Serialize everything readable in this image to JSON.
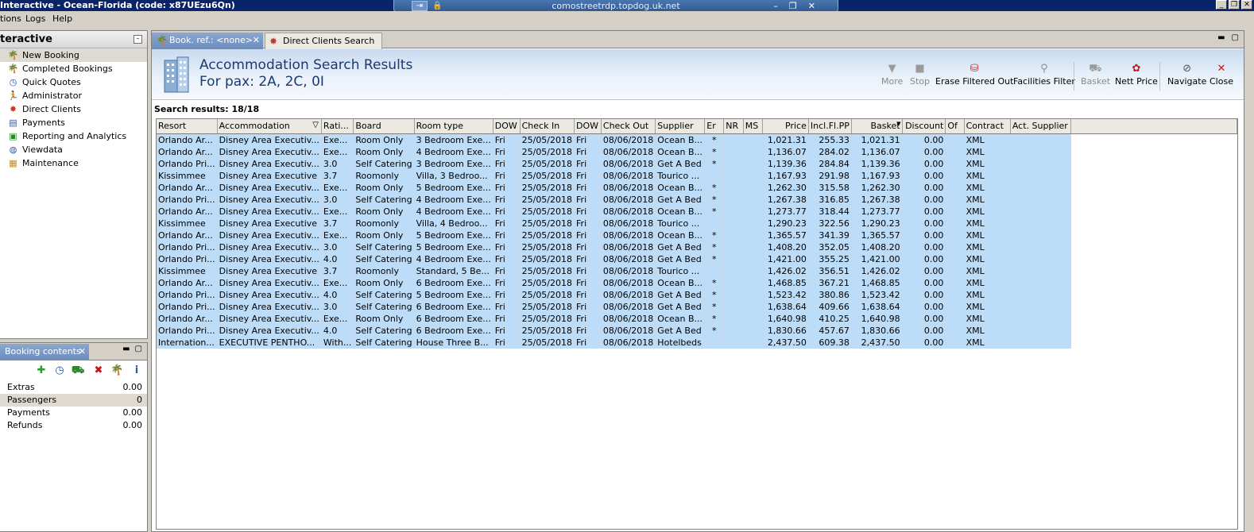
{
  "window": {
    "title": "Interactive - Ocean-Florida (code: x87UEzu6Qn)",
    "rdp_host": "comostreetrdp.topdog.uk.net"
  },
  "menu": [
    "tions",
    "Logs",
    "Help"
  ],
  "left_panel": {
    "title": "teractive",
    "items": [
      {
        "label": "New Booking",
        "icon": "palm-tree-icon"
      },
      {
        "label": "Completed Bookings",
        "icon": "palm-tree-icon"
      },
      {
        "label": "Quick Quotes",
        "icon": "clock-icon"
      },
      {
        "label": "Administrator",
        "icon": "person-icon"
      },
      {
        "label": "Direct Clients",
        "icon": "clients-icon"
      },
      {
        "label": "Payments",
        "icon": "payments-icon"
      },
      {
        "label": "Reporting and Analytics",
        "icon": "report-icon"
      },
      {
        "label": "Viewdata",
        "icon": "globe-icon"
      },
      {
        "label": "Maintenance",
        "icon": "books-icon"
      }
    ]
  },
  "booking_contents": {
    "tab_label": "Booking contents",
    "rows": [
      {
        "label": "Extras",
        "value": "0.00"
      },
      {
        "label": "Passengers",
        "value": "0"
      },
      {
        "label": "Payments",
        "value": "0.00"
      },
      {
        "label": "Refunds",
        "value": "0.00"
      }
    ]
  },
  "tabs": [
    {
      "label": "Book. ref.: <none>"
    },
    {
      "label": "Direct Clients Search"
    }
  ],
  "header": {
    "title": "Accommodation Search Results",
    "subtitle": "For pax: 2A, 2C, 0I"
  },
  "toolbar": {
    "more": "More",
    "stop": "Stop",
    "erase_filtered": "Erase Filtered Out",
    "facilities_filter": "Facilities Filter",
    "basket": "Basket",
    "nett_price": "Nett Price",
    "navigate": "Navigate",
    "close": "Close"
  },
  "results_label": "Search results: 18/18",
  "table": {
    "columns": [
      "Resort",
      "Accommodation",
      "Rati...",
      "Board",
      "Room type",
      "DOW",
      "Check In",
      "DOW",
      "Check Out",
      "Supplier",
      "Er",
      "NR",
      "MS",
      "Price",
      "Incl.Fl.PP",
      "Basket",
      "Discount",
      "Of",
      "Contract",
      "Act. Supplier"
    ],
    "rows": [
      [
        "Orlando Ar...",
        "Disney Area Executiv...",
        "Exe...",
        "Room Only",
        "3 Bedroom Exe...",
        "Fri",
        "25/05/2018",
        "Fri",
        "08/06/2018",
        "Ocean B...",
        "*",
        "",
        "",
        "1,021.31",
        "255.33",
        "1,021.31",
        "0.00",
        "",
        "XML",
        ""
      ],
      [
        "Orlando Ar...",
        "Disney Area Executiv...",
        "Exe...",
        "Room Only",
        "4 Bedroom Exe...",
        "Fri",
        "25/05/2018",
        "Fri",
        "08/06/2018",
        "Ocean B...",
        "*",
        "",
        "",
        "1,136.07",
        "284.02",
        "1,136.07",
        "0.00",
        "",
        "XML",
        ""
      ],
      [
        "Orlando Pri...",
        "Disney Area Executiv...",
        "3.0",
        "Self Catering",
        "3 Bedroom Exe...",
        "Fri",
        "25/05/2018",
        "Fri",
        "08/06/2018",
        "Get A Bed",
        "*",
        "",
        "",
        "1,139.36",
        "284.84",
        "1,139.36",
        "0.00",
        "",
        "XML",
        ""
      ],
      [
        "Kissimmee",
        "Disney Area Executive",
        "3.7",
        "Roomonly",
        "Villa, 3 Bedroo...",
        "Fri",
        "25/05/2018",
        "Fri",
        "08/06/2018",
        "Tourico ...",
        "",
        "",
        "",
        "1,167.93",
        "291.98",
        "1,167.93",
        "0.00",
        "",
        "XML",
        ""
      ],
      [
        "Orlando Ar...",
        "Disney Area Executiv...",
        "Exe...",
        "Room Only",
        "5 Bedroom Exe...",
        "Fri",
        "25/05/2018",
        "Fri",
        "08/06/2018",
        "Ocean B...",
        "*",
        "",
        "",
        "1,262.30",
        "315.58",
        "1,262.30",
        "0.00",
        "",
        "XML",
        ""
      ],
      [
        "Orlando Pri...",
        "Disney Area Executiv...",
        "3.0",
        "Self Catering",
        "4 Bedroom Exe...",
        "Fri",
        "25/05/2018",
        "Fri",
        "08/06/2018",
        "Get A Bed",
        "*",
        "",
        "",
        "1,267.38",
        "316.85",
        "1,267.38",
        "0.00",
        "",
        "XML",
        ""
      ],
      [
        "Orlando Ar...",
        "Disney Area Executiv...",
        "Exe...",
        "Room Only",
        "4 Bedroom Exe...",
        "Fri",
        "25/05/2018",
        "Fri",
        "08/06/2018",
        "Ocean B...",
        "*",
        "",
        "",
        "1,273.77",
        "318.44",
        "1,273.77",
        "0.00",
        "",
        "XML",
        ""
      ],
      [
        "Kissimmee",
        "Disney Area Executive",
        "3.7",
        "Roomonly",
        "Villa, 4 Bedroo...",
        "Fri",
        "25/05/2018",
        "Fri",
        "08/06/2018",
        "Tourico ...",
        "",
        "",
        "",
        "1,290.23",
        "322.56",
        "1,290.23",
        "0.00",
        "",
        "XML",
        ""
      ],
      [
        "Orlando Ar...",
        "Disney Area Executiv...",
        "Exe...",
        "Room Only",
        "5 Bedroom Exe...",
        "Fri",
        "25/05/2018",
        "Fri",
        "08/06/2018",
        "Ocean B...",
        "*",
        "",
        "",
        "1,365.57",
        "341.39",
        "1,365.57",
        "0.00",
        "",
        "XML",
        ""
      ],
      [
        "Orlando Pri...",
        "Disney Area Executiv...",
        "3.0",
        "Self Catering",
        "5 Bedroom Exe...",
        "Fri",
        "25/05/2018",
        "Fri",
        "08/06/2018",
        "Get A Bed",
        "*",
        "",
        "",
        "1,408.20",
        "352.05",
        "1,408.20",
        "0.00",
        "",
        "XML",
        ""
      ],
      [
        "Orlando Pri...",
        "Disney Area Executiv...",
        "4.0",
        "Self Catering",
        "4 Bedroom Exe...",
        "Fri",
        "25/05/2018",
        "Fri",
        "08/06/2018",
        "Get A Bed",
        "*",
        "",
        "",
        "1,421.00",
        "355.25",
        "1,421.00",
        "0.00",
        "",
        "XML",
        ""
      ],
      [
        "Kissimmee",
        "Disney Area Executive",
        "3.7",
        "Roomonly",
        "Standard, 5 Be...",
        "Fri",
        "25/05/2018",
        "Fri",
        "08/06/2018",
        "Tourico ...",
        "",
        "",
        "",
        "1,426.02",
        "356.51",
        "1,426.02",
        "0.00",
        "",
        "XML",
        ""
      ],
      [
        "Orlando Ar...",
        "Disney Area Executiv...",
        "Exe...",
        "Room Only",
        "6 Bedroom Exe...",
        "Fri",
        "25/05/2018",
        "Fri",
        "08/06/2018",
        "Ocean B...",
        "*",
        "",
        "",
        "1,468.85",
        "367.21",
        "1,468.85",
        "0.00",
        "",
        "XML",
        ""
      ],
      [
        "Orlando Pri...",
        "Disney Area Executiv...",
        "4.0",
        "Self Catering",
        "5 Bedroom Exe...",
        "Fri",
        "25/05/2018",
        "Fri",
        "08/06/2018",
        "Get A Bed",
        "*",
        "",
        "",
        "1,523.42",
        "380.86",
        "1,523.42",
        "0.00",
        "",
        "XML",
        ""
      ],
      [
        "Orlando Pri...",
        "Disney Area Executiv...",
        "3.0",
        "Self Catering",
        "6 Bedroom Exe...",
        "Fri",
        "25/05/2018",
        "Fri",
        "08/06/2018",
        "Get A Bed",
        "*",
        "",
        "",
        "1,638.64",
        "409.66",
        "1,638.64",
        "0.00",
        "",
        "XML",
        ""
      ],
      [
        "Orlando Ar...",
        "Disney Area Executiv...",
        "Exe...",
        "Room Only",
        "6 Bedroom Exe...",
        "Fri",
        "25/05/2018",
        "Fri",
        "08/06/2018",
        "Ocean B...",
        "*",
        "",
        "",
        "1,640.98",
        "410.25",
        "1,640.98",
        "0.00",
        "",
        "XML",
        ""
      ],
      [
        "Orlando Pri...",
        "Disney Area Executiv...",
        "4.0",
        "Self Catering",
        "6 Bedroom Exe...",
        "Fri",
        "25/05/2018",
        "Fri",
        "08/06/2018",
        "Get A Bed",
        "*",
        "",
        "",
        "1,830.66",
        "457.67",
        "1,830.66",
        "0.00",
        "",
        "XML",
        ""
      ],
      [
        "Internation...",
        "EXECUTIVE PENTHO...",
        "With...",
        "Self Catering",
        "House Three B...",
        "Fri",
        "25/05/2018",
        "Fri",
        "08/06/2018",
        "Hotelbeds",
        "",
        "",
        "",
        "2,437.50",
        "609.38",
        "2,437.50",
        "0.00",
        "",
        "XML",
        ""
      ]
    ]
  }
}
